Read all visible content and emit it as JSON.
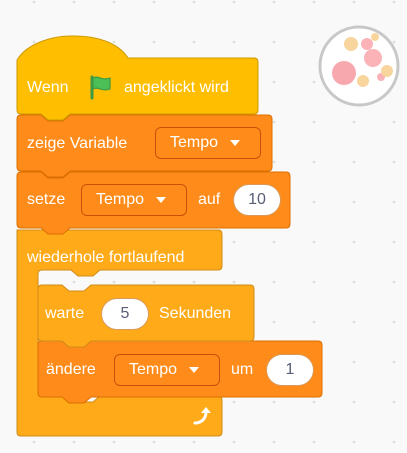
{
  "hat": {
    "prefix": "Wenn",
    "suffix": "angeklickt wird"
  },
  "show_variable": {
    "label": "zeige Variable",
    "variable": "Tempo"
  },
  "set_variable": {
    "label": "setze",
    "variable": "Tempo",
    "connector": "auf",
    "value": "10"
  },
  "forever": {
    "label": "wiederhole fortlaufend"
  },
  "wait": {
    "label": "warte",
    "value": "5",
    "unit": "Sekunden"
  },
  "change_variable": {
    "label": "ändere",
    "variable": "Tempo",
    "connector": "um",
    "value": "1"
  },
  "colors": {
    "events": "#ffbf00",
    "variables": "#ff8c1a",
    "control": "#ffab19",
    "flag": "#4cbf56"
  },
  "icons": {
    "flag": "green-flag-icon",
    "loop": "loop-arrow-icon",
    "sprite": "sprite-thumbnail-icon"
  }
}
